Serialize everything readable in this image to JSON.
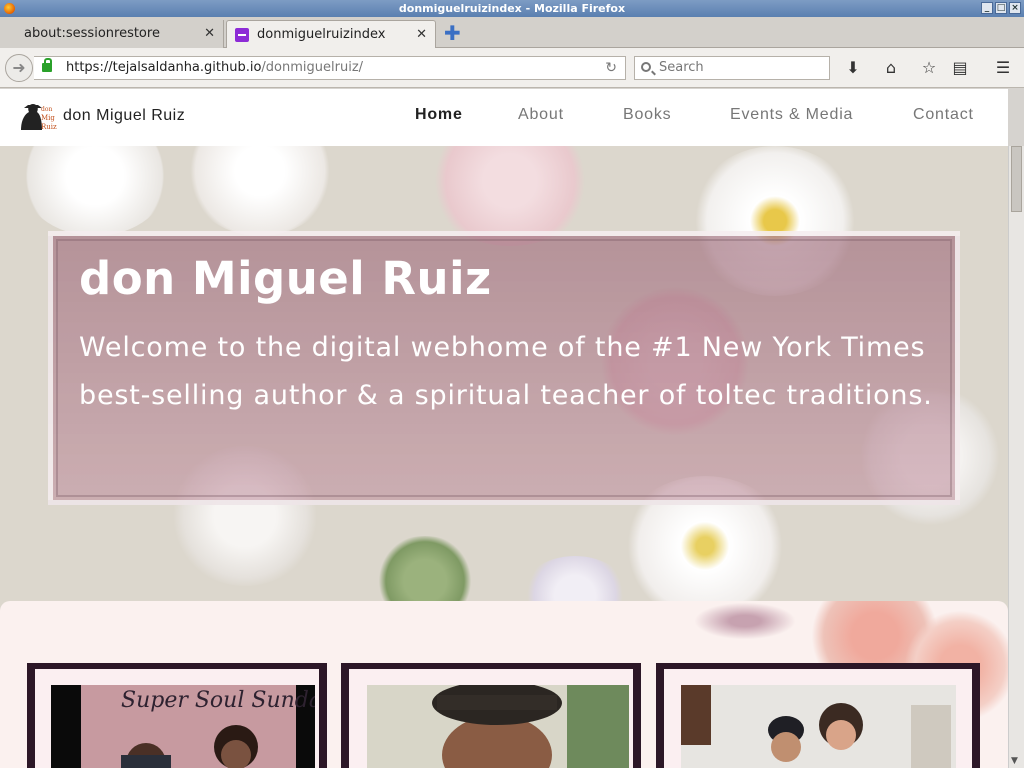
{
  "window": {
    "title": "donmiguelruizindex - Mozilla Firefox"
  },
  "tabs": [
    {
      "label": "about:sessionrestore",
      "active": false
    },
    {
      "label": "donmiguelruizindex",
      "active": true
    }
  ],
  "navbar": {
    "url_domain": "https://tejalsaldanha.github.io",
    "url_path": "/donmiguelruiz/",
    "search_placeholder": "Search"
  },
  "site": {
    "logo_text": "don Miguel Ruiz",
    "name": "don Miguel Ruiz",
    "nav": [
      {
        "label": "Home",
        "current": true
      },
      {
        "label": "About",
        "current": false
      },
      {
        "label": "Books",
        "current": false
      },
      {
        "label": "Events & Media",
        "current": false
      },
      {
        "label": "Contact",
        "current": false
      }
    ]
  },
  "hero": {
    "title": "don Miguel Ruiz",
    "text": "Welcome to the digital webhome of the #1 New York Times best-selling author & a spiritual teacher of toltec traditions."
  },
  "cards": [
    {
      "caption": "Super Soul Sunday"
    },
    {
      "caption": ""
    },
    {
      "caption": ""
    }
  ],
  "colors": {
    "accent": "#8d2bd6",
    "hero_overlay": "#a06e7d",
    "section_bg": "#fbf1ef",
    "frame": "#2c1727"
  }
}
